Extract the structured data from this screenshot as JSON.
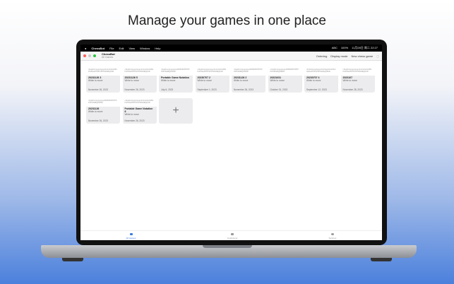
{
  "headline": "Manage your games in one place",
  "menubar": {
    "app": "ChessBot",
    "items": [
      "File",
      "Edit",
      "View",
      "Window",
      "Help"
    ],
    "status": [
      "ABC",
      "100%",
      "11月28日 周二 22:27"
    ]
  },
  "window": {
    "title": "ChessBot",
    "subtitle": "All Games",
    "toolbar": [
      "Ordering",
      "Display mode",
      "New chess game"
    ]
  },
  "games": [
    {
      "fen": "r1bqkb1r/pppp1ppp/2n2n2/4p3/2B1P3/5N2/PPPP1PPP/RNBQK2R",
      "name": "20231126 3",
      "turn": "White to move",
      "date": "November 26, 2023"
    },
    {
      "fen": "r1bqkb1r/pppp1ppp/2n2n2/4p3/2B1P3/5N2/PPPP1PPP/RNBQK2R",
      "name": "20231126 5",
      "turn": "White to move",
      "date": "November 26, 2023"
    },
    {
      "fen": "rnbqkbnr/pppppppp/8/8/8/8/PPPPPPPP/RNBQKBNR",
      "name": "Portable Game Notation",
      "turn": "White to move",
      "date": "July 6, 2023"
    },
    {
      "fen": "r1bqkb1r/pppp1ppp/2n2n2/4p3/2B1P3/5N2/PPPP1PPP/RNBQK2R",
      "name": "20230707 2",
      "turn": "White to move",
      "date": "September 1, 2023"
    },
    {
      "fen": "rnbqkbnr/pppppppp/8/8/8/8/PPPPPPPP/RNBQKBNR",
      "name": "20231126 2",
      "turn": "White to move",
      "date": "November 26, 2023"
    },
    {
      "fen": "rnbqkbnr/pppppppp/8/8/8/8/PPPPPPPP/RNBQKBNR",
      "name": "20231031",
      "turn": "White to move",
      "date": "October 31, 2023"
    },
    {
      "fen": "r1b1k2r/ppp2ppp/2n5/3qp3/1b1P4/2N2N2/PPP2PPP/R1BQKB1R",
      "name": "20230707 4",
      "turn": "White to move",
      "date": "September 12, 2023"
    },
    {
      "fen": "r1bqkb1r/pppp1ppp/2n2n2/4p3/2B1P3/5N2/PPPP1PPP/RNBQK2R",
      "name": "2023107",
      "turn": "White to move",
      "date": "November 28, 2023"
    },
    {
      "fen": "rnbqkbnr/pppppppp/8/8/8/8/PPPPPPPP/RNBQKBNR",
      "name": "20231126",
      "turn": "White to move",
      "date": "November 26, 2023"
    },
    {
      "fen": "r1bqkb1r/pppp1ppp/2n2n2/4p3/2B1P3/5N2/PPPP1PPP/RNBQK2R",
      "name": "Portable Game Notation 6",
      "turn": "White to move",
      "date": "November 26, 2023"
    }
  ],
  "add_label": "+",
  "tabs": [
    "All Games",
    "Guidebook",
    "Settings"
  ]
}
